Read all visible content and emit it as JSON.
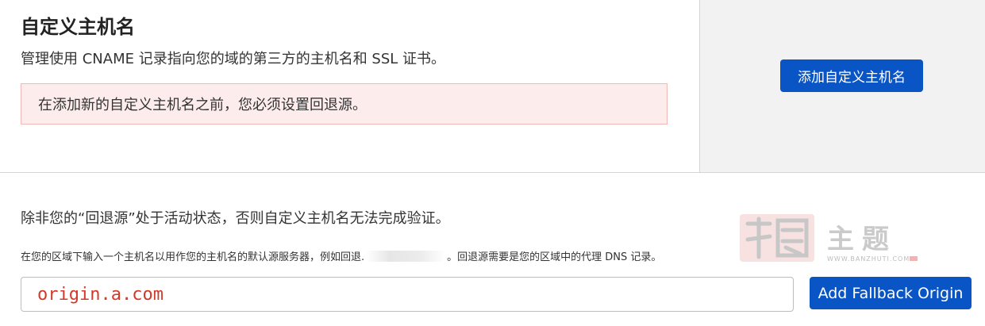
{
  "custom_hostnames": {
    "title": "自定义主机名",
    "subtitle": "管理使用 CNAME 记录指向您的域的第三方的主机名和 SSL 证书。",
    "alert": "在添加新的自定义主机名之前，您必须设置回退源。",
    "add_button": "添加自定义主机名"
  },
  "fallback_origin": {
    "description": "除非您的“回退源”处于活动状态，否则自定义主机名无法完成验证。",
    "help_before": "在您的区域下输入一个主机名以用作您的主机名的默认源服务器，例如回退.",
    "help_after": "。回退源需要是您的区域中的代理 DNS 记录。",
    "input_value": "origin.a.com",
    "button": "Add Fallback Origin"
  },
  "watermark": {
    "text": "主题",
    "url": "WWW.BANZHUTI.COM"
  },
  "colors": {
    "primary_button": "#0a55c5",
    "alert_bg": "#fdecec",
    "alert_border": "#f2b8b5",
    "input_text": "#d23a2a",
    "side_panel": "#f2f2f2"
  }
}
